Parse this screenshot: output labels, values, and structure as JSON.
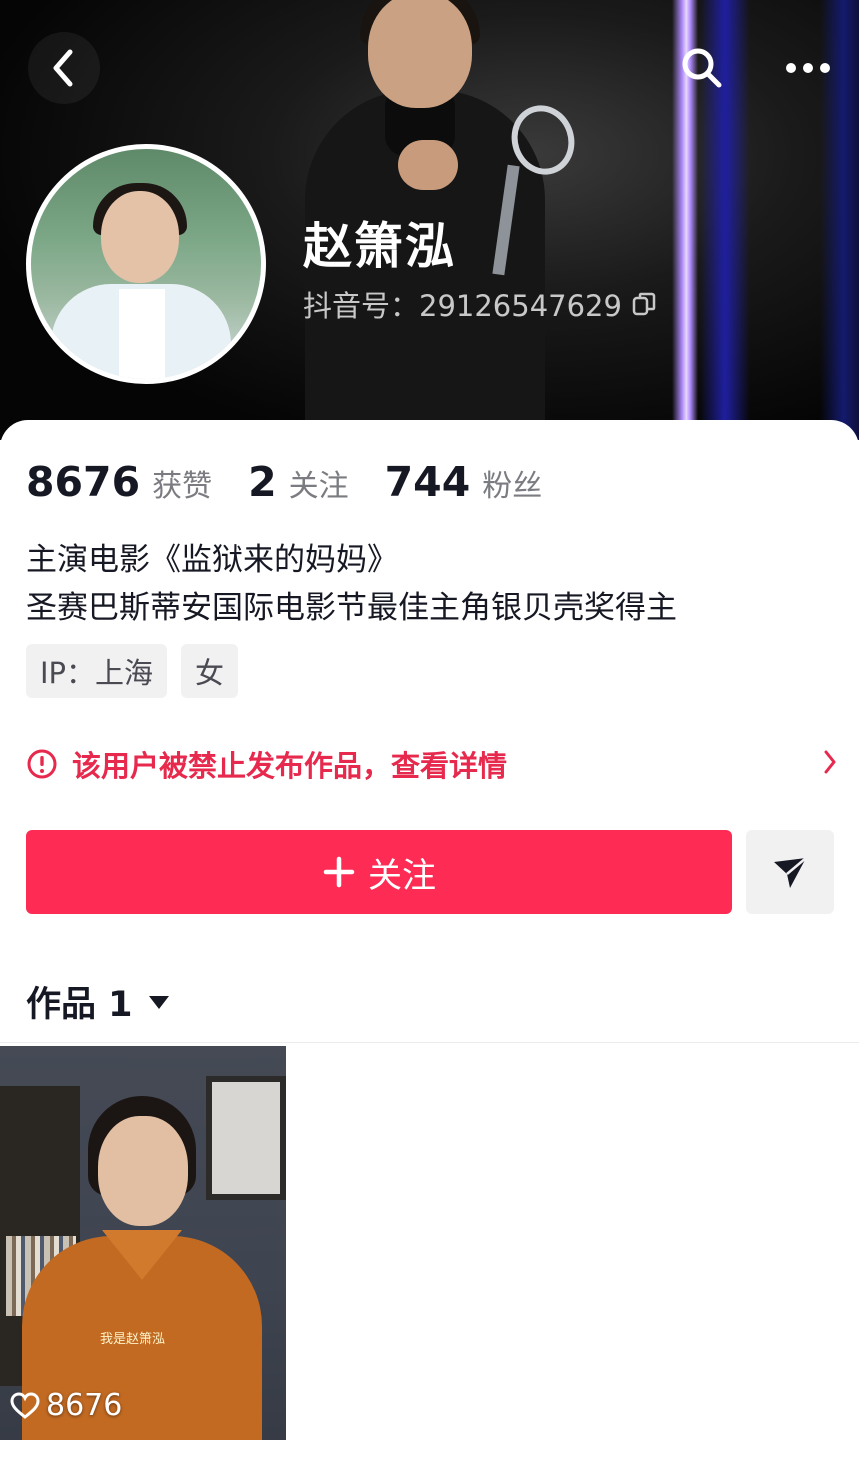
{
  "profile": {
    "name": "赵箫泓",
    "douyin_id": "抖音号：29126547629"
  },
  "stats": {
    "likes": {
      "value": "8676",
      "label": "获赞"
    },
    "following": {
      "value": "2",
      "label": "关注"
    },
    "followers": {
      "value": "744",
      "label": "粉丝"
    }
  },
  "bio": {
    "line1": "主演电影《监狱来的妈妈》",
    "line2": "圣赛巴斯蒂安国际电影节最佳主角银贝壳奖得主"
  },
  "tags": [
    "IP：上海",
    "女"
  ],
  "notice": {
    "text": "该用户被禁止发布作品，查看详情",
    "color": "#e6294d"
  },
  "actions": {
    "follow_label": "关注",
    "follow_color": "#fe2c55"
  },
  "works": {
    "label": "作品 1",
    "videos": [
      {
        "likes": "8676",
        "caption": "我是赵箫泓"
      }
    ]
  },
  "icons": [
    "back-arrow-icon",
    "search-icon",
    "more-icon",
    "copy-icon",
    "alert-icon",
    "chevron-right-icon",
    "plus-icon",
    "share-icon",
    "dropdown-icon",
    "heart-icon"
  ]
}
